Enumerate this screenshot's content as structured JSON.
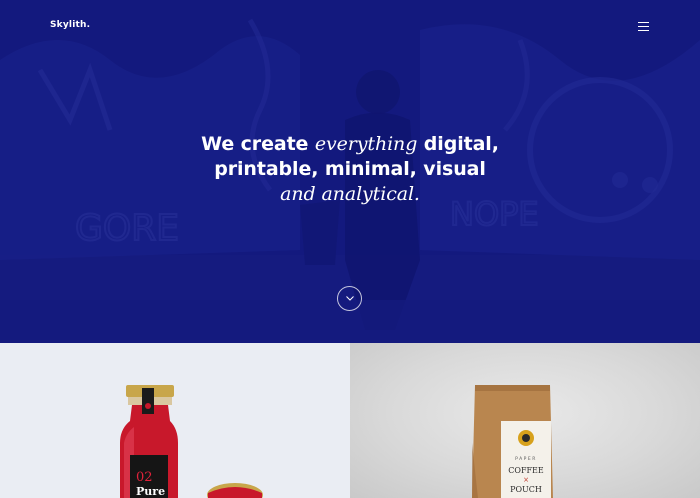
{
  "brand": {
    "name": "Skylith."
  },
  "hero": {
    "headline_line1_pre": "We create ",
    "headline_line1_em": "everything",
    "headline_line1_post": " digital,",
    "headline_line2": "printable, minimal, visual",
    "headline_line3_em": "and analytical.",
    "overlay_color": "#141a78"
  },
  "nav": {
    "menu_icon": "hamburger-icon",
    "scroll_icon": "chevron-down-icon"
  },
  "portfolio": {
    "items": [
      {
        "name": "bottle",
        "label_number": "02",
        "label_text": "Pure"
      },
      {
        "name": "coffee-pouch",
        "label_top": "PAPER",
        "label_line1": "COFFEE",
        "label_x": "×",
        "label_line2": "POUCH"
      }
    ]
  }
}
